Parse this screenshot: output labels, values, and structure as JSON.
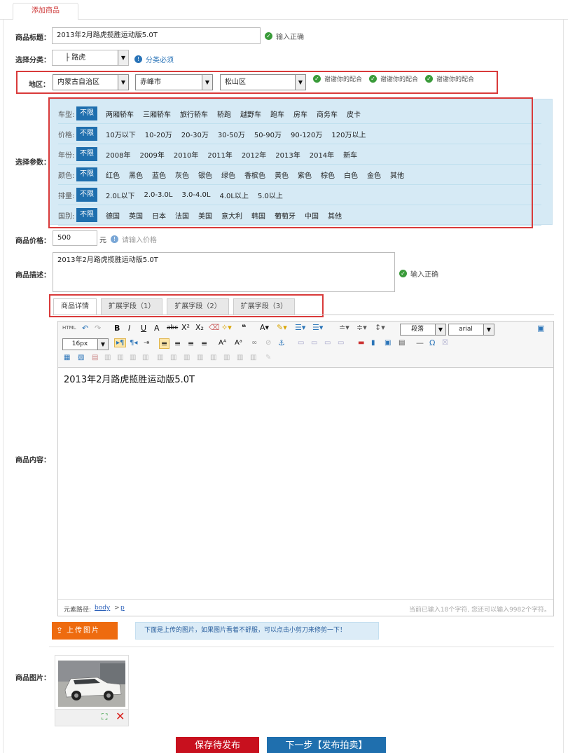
{
  "tab": {
    "label": "添加商品"
  },
  "title": {
    "label": "商品标题：",
    "value": "2013年2月路虎揽胜运动版5.0T",
    "ok": "输入正确"
  },
  "category": {
    "label": "选择分类：",
    "value": "├ 路虎",
    "hint": "分类必须"
  },
  "region": {
    "label": "地区：",
    "province": "内蒙古自治区",
    "city": "赤峰市",
    "district": "松山区",
    "msgs": [
      "谢谢你的配合",
      "谢谢你的配合",
      "谢谢你的配合"
    ]
  },
  "params": {
    "label": "选择参数：",
    "unlimited": "不限",
    "rows": [
      {
        "key": "车型:",
        "vals": [
          "两厢轿车",
          "三厢轿车",
          "旅行轿车",
          "轿跑",
          "越野车",
          "跑车",
          "房车",
          "商务车",
          "皮卡"
        ]
      },
      {
        "key": "价格:",
        "vals": [
          "10万以下",
          "10-20万",
          "20-30万",
          "30-50万",
          "50-90万",
          "90-120万",
          "120万以上"
        ]
      },
      {
        "key": "年份:",
        "vals": [
          "2008年",
          "2009年",
          "2010年",
          "2011年",
          "2012年",
          "2013年",
          "2014年",
          "新车"
        ]
      },
      {
        "key": "颜色:",
        "vals": [
          "红色",
          "黑色",
          "蓝色",
          "灰色",
          "银色",
          "绿色",
          "香槟色",
          "黄色",
          "紫色",
          "棕色",
          "白色",
          "金色",
          "其他"
        ]
      },
      {
        "key": "排量:",
        "vals": [
          "2.0L以下",
          "2.0-3.0L",
          "3.0-4.0L",
          "4.0L以上",
          "5.0以上"
        ]
      },
      {
        "key": "国别:",
        "vals": [
          "德国",
          "英国",
          "日本",
          "法国",
          "美国",
          "意大利",
          "韩国",
          "葡萄牙",
          "中国",
          "其他"
        ]
      }
    ]
  },
  "price": {
    "label": "商品价格：",
    "value": "500",
    "unit": "元",
    "hint": "请输入价格"
  },
  "desc": {
    "label": "商品描述：",
    "value": "2013年2月路虎揽胜运动版5.0T",
    "ok": "输入正确"
  },
  "content_tabs": [
    "商品详情",
    "扩展字段（1）",
    "扩展字段（2）",
    "扩展字段（3）"
  ],
  "editor": {
    "label": "商品内容：",
    "font_size": "16px",
    "paragraph": "段落",
    "font": "arial",
    "text": "2013年2月路虎揽胜运动版5.0T",
    "path_label": "元素路径:",
    "path_body": "body",
    "path_sep": ">",
    "path_p": "p",
    "counter": "当前已输入18个字符, 您还可以输入9982个字符。"
  },
  "upload": {
    "button": "上传图片",
    "tip": "下面是上传的图片，如果图片看着不舒服，可以点击小剪刀来修剪一下！"
  },
  "images": {
    "label": "商品图片："
  },
  "buttons": {
    "save": "保存待发布",
    "next": "下一步【发布拍卖】"
  },
  "colors": {
    "accent": "#1f6fae",
    "red_box": "#d93a3a",
    "save_btn": "#c8101e",
    "next_btn": "#1f6fae",
    "upload_btn": "#ee6b0f",
    "params_bg": "#d6eaf5"
  }
}
